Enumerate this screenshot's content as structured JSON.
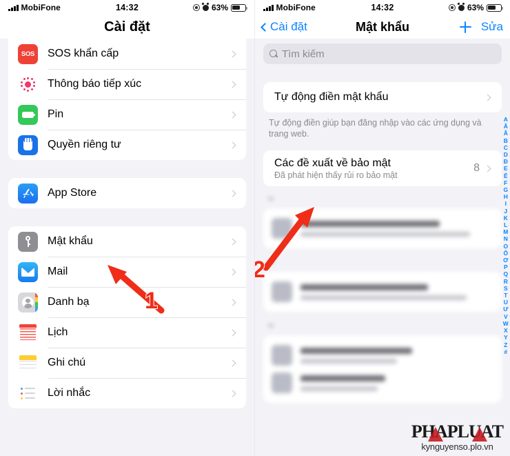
{
  "status_bar": {
    "carrier": "MobiFone",
    "time": "14:32",
    "battery_percent": "63%",
    "signal_icon": "signal-bars-icon",
    "location_icon": "location-services-icon",
    "alarm_icon": "alarm-clock-icon",
    "battery_icon": "battery-icon"
  },
  "colors": {
    "accent_blue": "#0a84ff",
    "arrow_red": "#ef2d18",
    "group_bg": "#ffffff",
    "page_bg": "#f2f2f7",
    "secondary_text": "#8a8a8f"
  },
  "left_screen": {
    "nav_title": "Cài đặt",
    "group_one": [
      {
        "label": "SOS khẩn cấp",
        "icon": "sos-icon"
      },
      {
        "label": "Thông báo tiếp xúc",
        "icon": "exposure-notification-icon"
      },
      {
        "label": "Pin",
        "icon": "battery-settings-icon"
      },
      {
        "label": "Quyền riêng tư",
        "icon": "privacy-hand-icon"
      }
    ],
    "group_two": [
      {
        "label": "App Store",
        "icon": "app-store-icon"
      }
    ],
    "group_three": [
      {
        "label": "Mật khẩu",
        "icon": "passwords-key-icon"
      },
      {
        "label": "Mail",
        "icon": "mail-icon"
      },
      {
        "label": "Danh bạ",
        "icon": "contacts-icon"
      },
      {
        "label": "Lịch",
        "icon": "calendar-icon"
      },
      {
        "label": "Ghi chú",
        "icon": "notes-icon"
      },
      {
        "label": "Lời nhắc",
        "icon": "reminders-icon"
      }
    ]
  },
  "right_screen": {
    "back_label": "Cài đặt",
    "nav_title": "Mật khẩu",
    "add_icon": "plus-icon",
    "edit_label": "Sửa",
    "search": {
      "placeholder": "Tìm kiếm",
      "icon": "search-icon"
    },
    "autofill": {
      "title": "Tự động điền mật khẩu",
      "footnote": "Tự động điền giúp bạn đăng nhập vào các ứng dụng và trang web."
    },
    "security": {
      "title": "Các đề xuất về bảo mật",
      "subtitle": "Đã phát hiện thấy rủi ro bảo mật",
      "count": "8"
    },
    "index_letters": [
      "A",
      "Ă",
      "Â",
      "B",
      "C",
      "D",
      "Đ",
      "E",
      "Ê",
      "F",
      "G",
      "H",
      "I",
      "J",
      "K",
      "L",
      "M",
      "N",
      "O",
      "Ô",
      "Ơ",
      "P",
      "Q",
      "R",
      "S",
      "T",
      "U",
      "Ư",
      "V",
      "W",
      "X",
      "Y",
      "Z",
      "#"
    ]
  },
  "annotations": {
    "step_one": "1",
    "step_two": "2"
  },
  "watermark": {
    "title": "PHAPLUAT",
    "url": "kynguyenso.plo.vn"
  }
}
